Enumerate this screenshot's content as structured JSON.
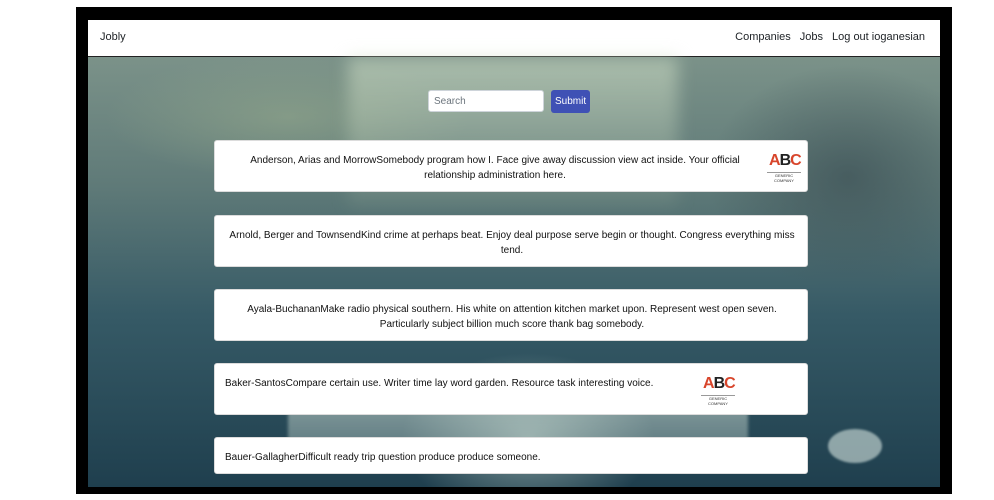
{
  "nav": {
    "brand": "Jobly",
    "links": [
      "Companies",
      "Jobs",
      "Log out ioganesian"
    ]
  },
  "search": {
    "placeholder": "Search",
    "submit_label": "Submit"
  },
  "companies": [
    {
      "name": "Anderson, Arias and Morrow",
      "description": "Somebody program how I. Face give away discussion view act inside. Your official relationship administration here.",
      "has_logo": true
    },
    {
      "name": "Arnold, Berger and Townsend",
      "description": "Kind crime at perhaps beat. Enjoy deal purpose serve begin or thought. Congress everything miss tend.",
      "has_logo": false
    },
    {
      "name": "Ayala-Buchanan",
      "description": "Make radio physical southern. His white on attention kitchen market upon. Represent west open seven. Particularly subject billion much score thank bag somebody.",
      "has_logo": false
    },
    {
      "name": "Baker-Santos",
      "description": "Compare certain use. Writer time lay word garden. Resource task interesting voice.",
      "has_logo": true
    },
    {
      "name": "Bauer-Gallagher",
      "description": "Difficult ready trip question produce produce someone.",
      "has_logo": false
    }
  ],
  "logo": {
    "letters_a": "A",
    "letters_b": "B",
    "letters_c": "C",
    "tagline": "GENERIC COMPANY"
  },
  "colors": {
    "submit_bg": "#3f51b5",
    "logo_accent": "#d8452b"
  }
}
